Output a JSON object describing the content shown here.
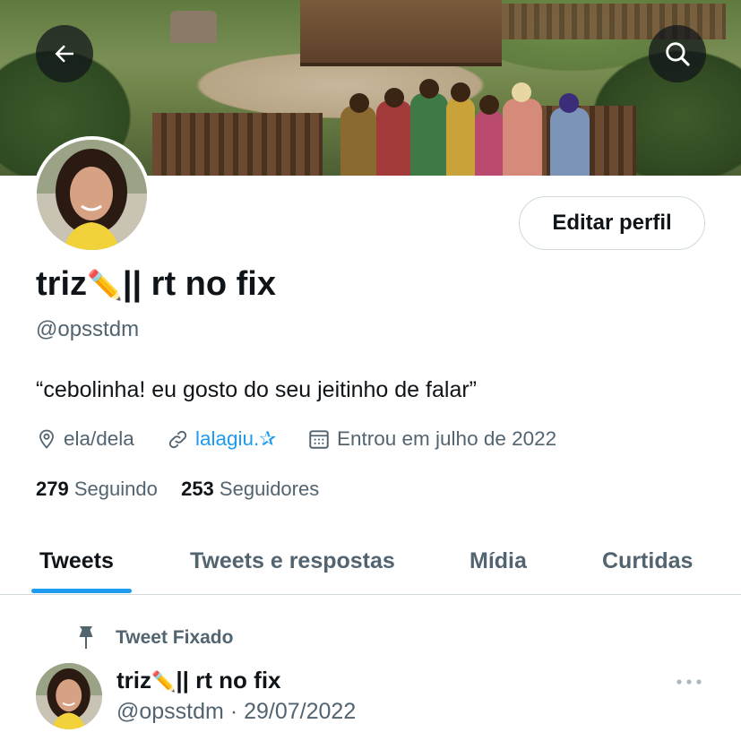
{
  "header": {
    "back_icon": "arrow-left-icon",
    "search_icon": "search-icon"
  },
  "profile": {
    "edit_button_label": "Editar perfil",
    "display_name_prefix": "triz",
    "display_name_emoji": "✏️",
    "display_name_suffix": "|| rt no fix",
    "handle": "@opsstdm",
    "bio": "“cebolinha! eu gosto do seu jeitinho de falar”",
    "location": "ela/dela",
    "link": "lalagiu.✰",
    "joined": "Entrou em julho de 2022",
    "following_count": "279",
    "following_label": "Seguindo",
    "followers_count": "253",
    "followers_label": "Seguidores"
  },
  "tabs": [
    {
      "label": "Tweets",
      "active": true
    },
    {
      "label": "Tweets e respostas",
      "active": false
    },
    {
      "label": "Mídia",
      "active": false
    },
    {
      "label": "Curtidas",
      "active": false
    }
  ],
  "pinned_tweet": {
    "pin_label": "Tweet Fixado",
    "author_name_prefix": "triz",
    "author_name_emoji": "✏️",
    "author_name_suffix": "|| rt no fix",
    "author_handle": "@opsstdm",
    "separator": "·",
    "date": "29/07/2022"
  },
  "colors": {
    "accent": "#1d9bf0",
    "text_primary": "#0f1419",
    "text_secondary": "#536471",
    "border": "#cfd9de"
  }
}
